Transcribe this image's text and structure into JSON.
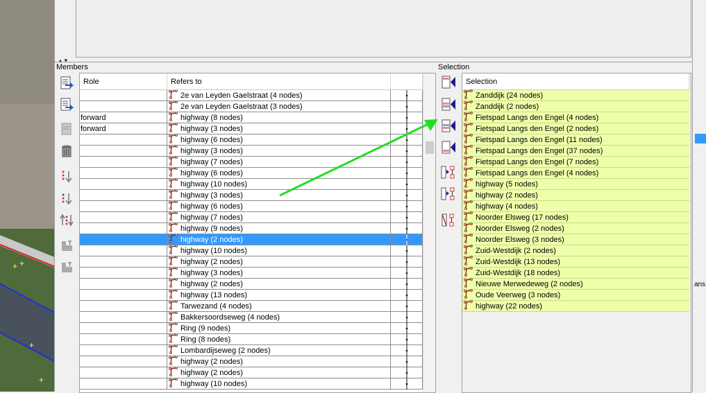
{
  "members_label": "Members",
  "selection_label": "Selection",
  "members_table": {
    "col_role": "Role",
    "col_refers": "Refers to",
    "rows": [
      {
        "role": "",
        "ref": "2e van Leyden Gaelstraat (4 nodes)",
        "selected": false
      },
      {
        "role": "",
        "ref": "2e van Leyden Gaelstraat (3 nodes)",
        "selected": false
      },
      {
        "role": "forward",
        "ref": "highway (8 nodes)",
        "selected": false
      },
      {
        "role": "forward",
        "ref": "highway (3 nodes)",
        "selected": false
      },
      {
        "role": "",
        "ref": "highway (6 nodes)",
        "selected": false
      },
      {
        "role": "",
        "ref": "highway (3 nodes)",
        "selected": false
      },
      {
        "role": "",
        "ref": "highway (7 nodes)",
        "selected": false
      },
      {
        "role": "",
        "ref": "highway (6 nodes)",
        "selected": false
      },
      {
        "role": "",
        "ref": "highway (10 nodes)",
        "selected": false
      },
      {
        "role": "",
        "ref": "highway (3 nodes)",
        "selected": false
      },
      {
        "role": "",
        "ref": "highway (6 nodes)",
        "selected": false
      },
      {
        "role": "",
        "ref": "highway (7 nodes)",
        "selected": false
      },
      {
        "role": "",
        "ref": "highway (9 nodes)",
        "selected": false
      },
      {
        "role": "",
        "ref": "highway (2 nodes)",
        "selected": true
      },
      {
        "role": "",
        "ref": "highway (10 nodes)",
        "selected": false
      },
      {
        "role": "",
        "ref": "highway (2 nodes)",
        "selected": false
      },
      {
        "role": "",
        "ref": "highway (3 nodes)",
        "selected": false
      },
      {
        "role": "",
        "ref": "highway (2 nodes)",
        "selected": false
      },
      {
        "role": "",
        "ref": "highway (13 nodes)",
        "selected": false
      },
      {
        "role": "",
        "ref": "Tarwezand (4 nodes)",
        "selected": false
      },
      {
        "role": "",
        "ref": "Bakkersoordseweg (4 nodes)",
        "selected": false
      },
      {
        "role": "",
        "ref": "Ring (9 nodes)",
        "selected": false
      },
      {
        "role": "",
        "ref": "Ring (8 nodes)",
        "selected": false
      },
      {
        "role": "",
        "ref": "Lombardijseweg (2 nodes)",
        "selected": false
      },
      {
        "role": "",
        "ref": "highway (2 nodes)",
        "selected": false
      },
      {
        "role": "",
        "ref": "highway (2 nodes)",
        "selected": false
      },
      {
        "role": "",
        "ref": "highway (10 nodes)",
        "selected": false
      }
    ]
  },
  "selection_table": {
    "col": "Selection",
    "rows": [
      "Zanddijk (24 nodes)",
      "Zanddijk (2 nodes)",
      "Fietspad Langs den Engel (4 nodes)",
      "Fietspad Langs den Engel (2 nodes)",
      "Fietspad Langs den Engel (11 nodes)",
      "Fietspad Langs den Engel (37 nodes)",
      "Fietspad Langs den Engel (7 nodes)",
      "Fietspad Langs den Engel (4 nodes)",
      "highway (5 nodes)",
      "highway (2 nodes)",
      "highway (4 nodes)",
      "Noorder Elsweg (17 nodes)",
      "Noorder Elsweg (2 nodes)",
      "Noorder Elsweg (3 nodes)",
      "Zuid-Westdijk (2 nodes)",
      "Zuid-Westdijk (13 nodes)",
      "Zuid-Westdijk (18 nodes)",
      "Nieuwe Merwedeweg (2 nodes)",
      "Oude Veerweg (3 nodes)",
      "highway (22 nodes)"
    ]
  },
  "member_tools": [
    "sort-icon",
    "reverse-sort-icon",
    "edit-icon",
    "delete-icon",
    "move-up-icon",
    "move-down-icon",
    "move-both-icon",
    "download-member-icon",
    "download-incomplete-icon"
  ],
  "selection_tools": [
    "add-at-start-icon",
    "add-before-icon",
    "add-after-icon",
    "add-at-end-icon",
    "select-members-icon",
    "select-in-selection-icon",
    "remove-selected-icon"
  ],
  "colors": {
    "selection_bg": "#eeffaa",
    "row_selected": "#3399ff",
    "annotation_arrow": "#22dd22"
  },
  "right_edge_text": "ans"
}
